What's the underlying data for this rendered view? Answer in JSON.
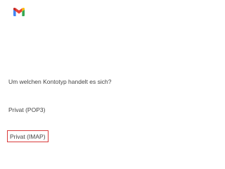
{
  "app": {
    "logo_icon": "gmail-logo-icon",
    "brand_colors": [
      "#ea4335",
      "#4285f4",
      "#34a853",
      "#fbbc04",
      "#c5221f"
    ]
  },
  "account_type_prompt": {
    "question": "Um welchen Kontotyp handelt es sich?",
    "options": [
      {
        "label": "Privat (POP3)",
        "highlighted": false
      },
      {
        "label": "Privat (IMAP)",
        "highlighted": true
      }
    ],
    "highlight_color": "#d93b3b"
  }
}
